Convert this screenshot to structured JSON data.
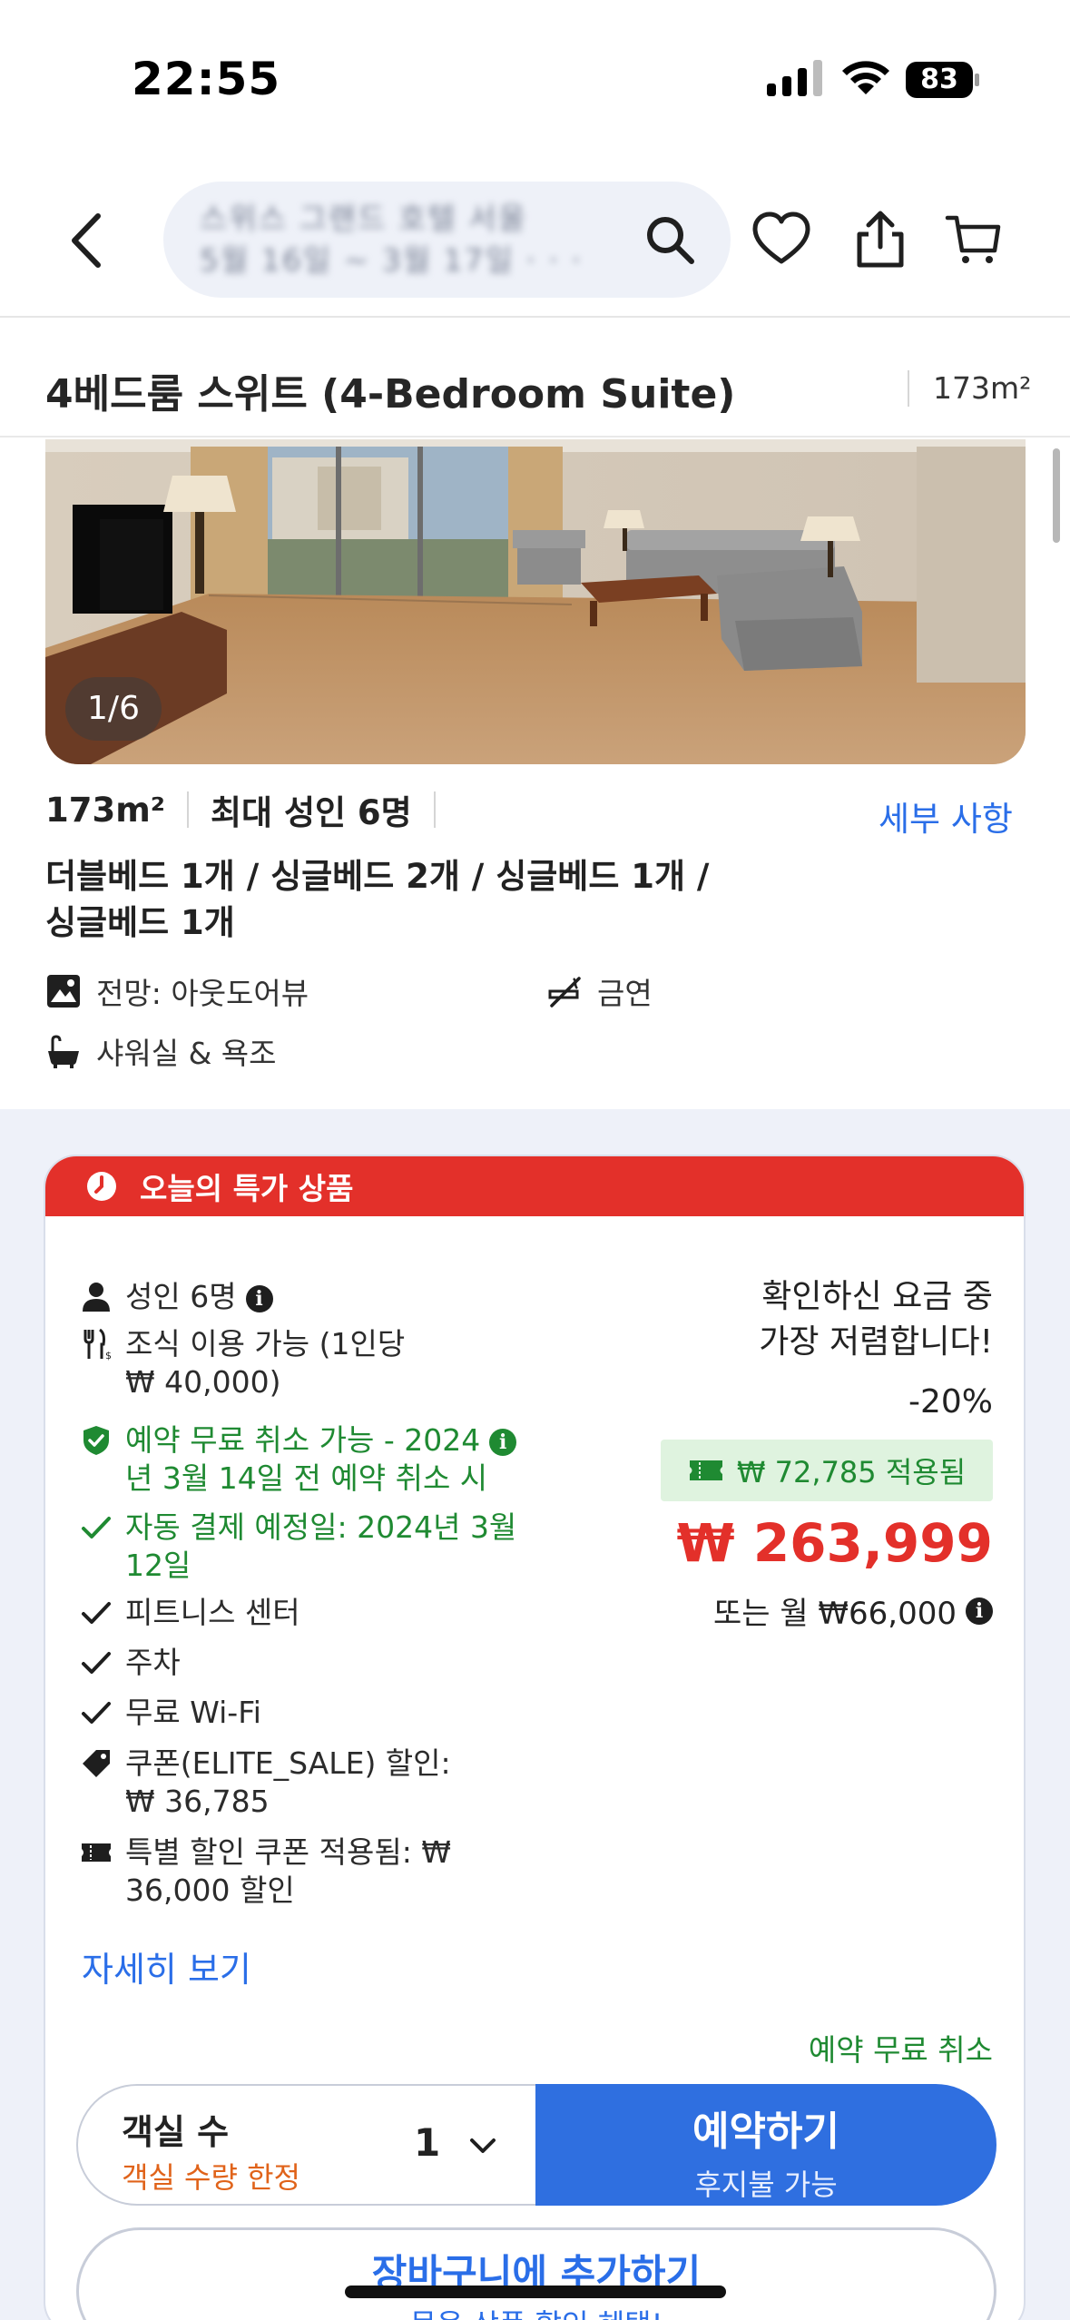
{
  "status_bar": {
    "time": "22:55",
    "battery": "83"
  },
  "header": {
    "search_text_line1": "스위스 그랜드 호텔 서울",
    "search_text_line2": "5월 16일 ~ 3월 17일 · · ·"
  },
  "room": {
    "title": "4베드룸 스위트 (4-Bedroom Suite)",
    "size_right": "173m²",
    "photo_counter": "1/6",
    "size": "173m²",
    "max_adults": "최대 성인 6명",
    "details_link": "세부 사항",
    "beds_line1": "더블베드 1개 / 싱글베드 2개 / 싱글베드 1개 /",
    "beds_line2": "싱글베드 1개",
    "features": {
      "view": "전망: 아웃도어뷰",
      "smoking": "금연",
      "bath": "샤워실 & 욕조"
    }
  },
  "deal": {
    "banner": "오늘의 특가 상품",
    "inclusions": {
      "adults": "성인 6명",
      "breakfast_line1": "조식 이용 가능 (1인당",
      "breakfast_line2": "₩ 40,000)",
      "free_cancel_line1": "예약 무료 취소 가능 - 2024",
      "free_cancel_line2": "년 3월 14일 전 예약 취소 시",
      "auto_pay_line1": "자동 결제 예정일: 2024년 3월",
      "auto_pay_line2": "12일",
      "fitness": "피트니스 센터",
      "parking": "주차",
      "wifi": "무료 Wi-Fi",
      "coupon_line1": "쿠폰(ELITE_SALE) 할인:",
      "coupon_line2": "₩ 36,785",
      "special_line1": "특별 할인 쿠폰 적용됨: ₩",
      "special_line2": "36,000 할인"
    },
    "more_link": "자세히 보기",
    "price_note_line1": "확인하신 요금 중",
    "price_note_line2": "가장 저렴합니다!",
    "discount": "-20%",
    "coupon_applied": "₩ 72,785 적용됨",
    "price": "₩ 263,999",
    "monthly": "또는 월 ₩66,000",
    "free_cancel": "예약 무료 취소",
    "rooms_label": "객실 수",
    "rooms_limited": "객실 수량 한정",
    "rooms_value": "1",
    "book_label": "예약하기",
    "book_sub": "후지불 가능",
    "cart_label": "장바구니에 추가하기",
    "cart_sub": "묶음 상품 할인 혜택!"
  },
  "colors": {
    "accent": "#2f6fe0",
    "deal_red": "#e3302a",
    "green": "#1f8a32"
  }
}
